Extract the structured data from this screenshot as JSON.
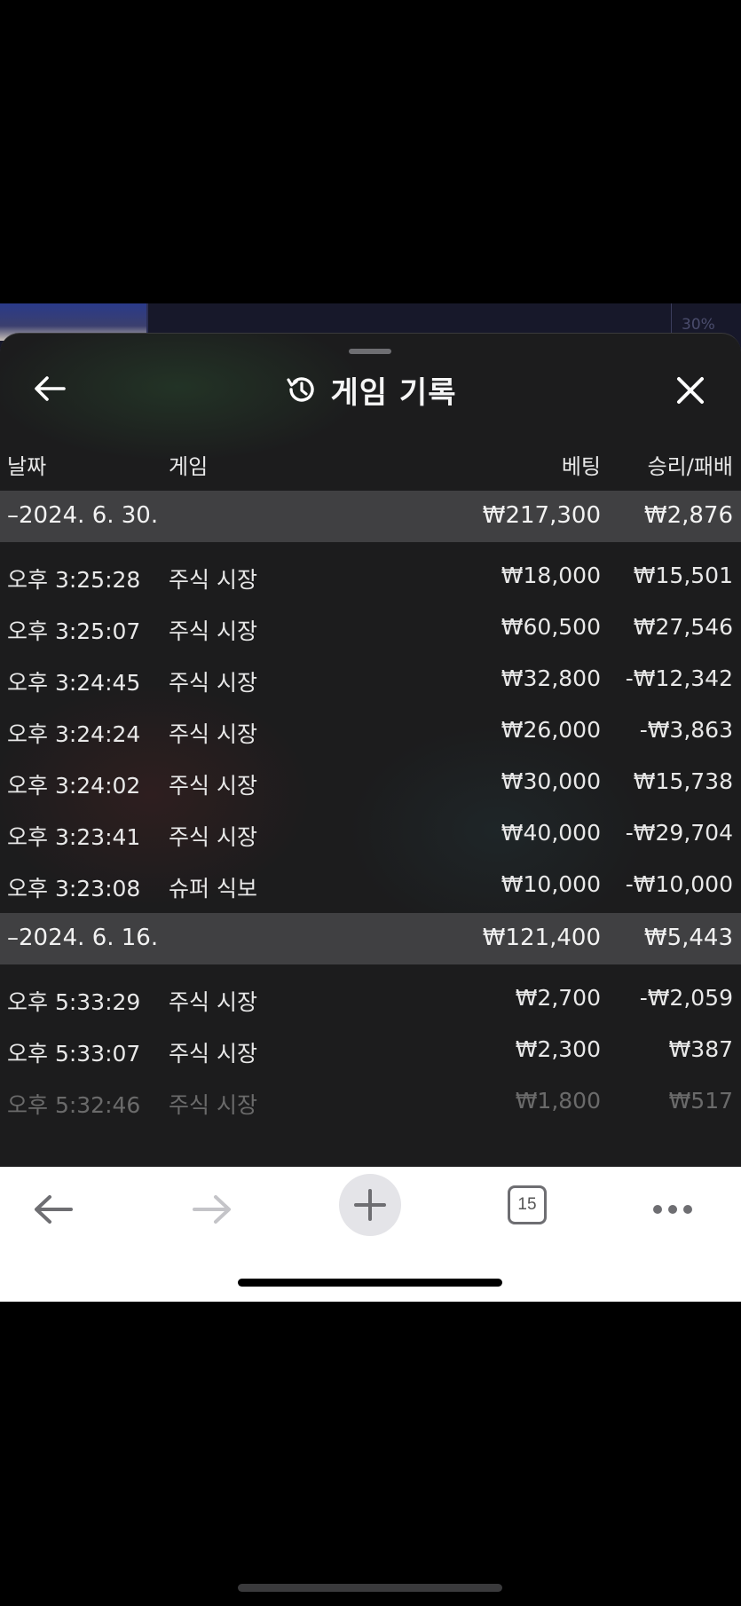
{
  "sheet": {
    "title": "게임 기록",
    "columns": {
      "date": "날짜",
      "game": "게임",
      "bet": "베팅",
      "win_loss": "승리/패배"
    }
  },
  "background": {
    "percent_label": "30%"
  },
  "groups": [
    {
      "date": "–2024. 6. 30.",
      "bet_total": "₩217,300",
      "win_total": "₩2,876",
      "rows": [
        {
          "time": "오후 3:25:28",
          "game": "주식 시장",
          "bet": "₩18,000",
          "win": "₩15,501"
        },
        {
          "time": "오후 3:25:07",
          "game": "주식 시장",
          "bet": "₩60,500",
          "win": "₩27,546"
        },
        {
          "time": "오후 3:24:45",
          "game": "주식 시장",
          "bet": "₩32,800",
          "win": "-₩12,342"
        },
        {
          "time": "오후 3:24:24",
          "game": "주식 시장",
          "bet": "₩26,000",
          "win": "-₩3,863"
        },
        {
          "time": "오후 3:24:02",
          "game": "주식 시장",
          "bet": "₩30,000",
          "win": "₩15,738"
        },
        {
          "time": "오후 3:23:41",
          "game": "주식 시장",
          "bet": "₩40,000",
          "win": "-₩29,704"
        },
        {
          "time": "오후 3:23:08",
          "game": "슈퍼 식보",
          "bet": "₩10,000",
          "win": "-₩10,000"
        }
      ]
    },
    {
      "date": "–2024. 6. 16.",
      "bet_total": "₩121,400",
      "win_total": "₩5,443",
      "rows": [
        {
          "time": "오후 5:33:29",
          "game": "주식 시장",
          "bet": "₩2,700",
          "win": "-₩2,059"
        },
        {
          "time": "오후 5:33:07",
          "game": "주식 시장",
          "bet": "₩2,300",
          "win": "₩387"
        },
        {
          "time": "오후 5:32:46",
          "game": "주식 시장",
          "bet": "₩1,800",
          "win": "₩517"
        }
      ]
    }
  ],
  "toolbar": {
    "tabs_count": "15",
    "icons": [
      "back-arrow-icon",
      "forward-arrow-icon",
      "plus-icon",
      "tabs-icon",
      "more-icon"
    ]
  },
  "colors": {
    "sheet_bg": "#1c1c1d",
    "group_row_bg": "#404042",
    "toolbar_bg": "#ffffff"
  }
}
